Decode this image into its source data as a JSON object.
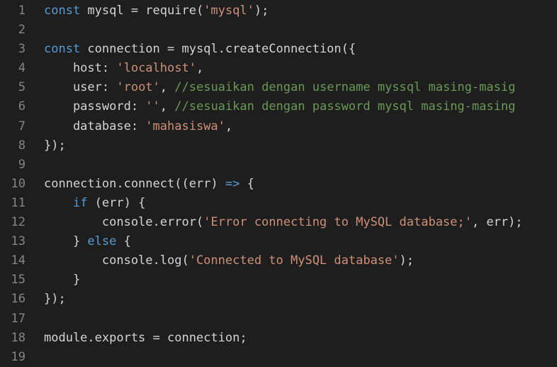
{
  "colors": {
    "background": "#1e1e1e",
    "line_number": "#858585",
    "default_text": "#d4d4d4",
    "keyword": "#569cd6",
    "string": "#ce9178",
    "comment": "#6a9955"
  },
  "lines": [
    {
      "n": "1",
      "parts": [
        {
          "t": "const",
          "c": "kw"
        },
        {
          "t": " mysql = require(",
          "c": "op"
        },
        {
          "t": "'mysql'",
          "c": "str"
        },
        {
          "t": ");",
          "c": "op"
        }
      ]
    },
    {
      "n": "2",
      "parts": []
    },
    {
      "n": "3",
      "parts": [
        {
          "t": "const",
          "c": "kw"
        },
        {
          "t": " connection = mysql.createConnection({",
          "c": "op"
        }
      ]
    },
    {
      "n": "4",
      "parts": [
        {
          "t": "    host: ",
          "c": "op"
        },
        {
          "t": "'localhost'",
          "c": "str"
        },
        {
          "t": ",",
          "c": "op"
        }
      ]
    },
    {
      "n": "5",
      "parts": [
        {
          "t": "    user: ",
          "c": "op"
        },
        {
          "t": "'root'",
          "c": "str"
        },
        {
          "t": ", ",
          "c": "op"
        },
        {
          "t": "//sesuaikan dengan username myssql masing-masig",
          "c": "cm"
        }
      ]
    },
    {
      "n": "6",
      "parts": [
        {
          "t": "    password: ",
          "c": "op"
        },
        {
          "t": "''",
          "c": "str"
        },
        {
          "t": ", ",
          "c": "op"
        },
        {
          "t": "//sesuaikan dengan password mysql masing-masing",
          "c": "cm"
        }
      ]
    },
    {
      "n": "7",
      "parts": [
        {
          "t": "    database: ",
          "c": "op"
        },
        {
          "t": "'mahasiswa'",
          "c": "str"
        },
        {
          "t": ",",
          "c": "op"
        }
      ]
    },
    {
      "n": "8",
      "parts": [
        {
          "t": "});",
          "c": "op"
        }
      ]
    },
    {
      "n": "9",
      "parts": []
    },
    {
      "n": "10",
      "parts": [
        {
          "t": "connection.connect((err) ",
          "c": "op"
        },
        {
          "t": "=>",
          "c": "kw"
        },
        {
          "t": " {",
          "c": "op"
        }
      ]
    },
    {
      "n": "11",
      "parts": [
        {
          "t": "    ",
          "c": "op"
        },
        {
          "t": "if",
          "c": "kw"
        },
        {
          "t": " (err) {",
          "c": "op"
        }
      ]
    },
    {
      "n": "12",
      "parts": [
        {
          "t": "        console.error(",
          "c": "op"
        },
        {
          "t": "'Error connecting to MySQL database;'",
          "c": "str"
        },
        {
          "t": ", err);",
          "c": "op"
        }
      ]
    },
    {
      "n": "13",
      "parts": [
        {
          "t": "    } ",
          "c": "op"
        },
        {
          "t": "else",
          "c": "kw"
        },
        {
          "t": " {",
          "c": "op"
        }
      ]
    },
    {
      "n": "14",
      "parts": [
        {
          "t": "        console.log(",
          "c": "op"
        },
        {
          "t": "'Connected to MySQL database'",
          "c": "str"
        },
        {
          "t": ");",
          "c": "op"
        }
      ]
    },
    {
      "n": "15",
      "parts": [
        {
          "t": "    }",
          "c": "op"
        }
      ]
    },
    {
      "n": "16",
      "parts": [
        {
          "t": "});",
          "c": "op"
        }
      ]
    },
    {
      "n": "17",
      "parts": []
    },
    {
      "n": "18",
      "parts": [
        {
          "t": "module.exports = connection;",
          "c": "op"
        }
      ]
    },
    {
      "n": "19",
      "parts": []
    }
  ]
}
